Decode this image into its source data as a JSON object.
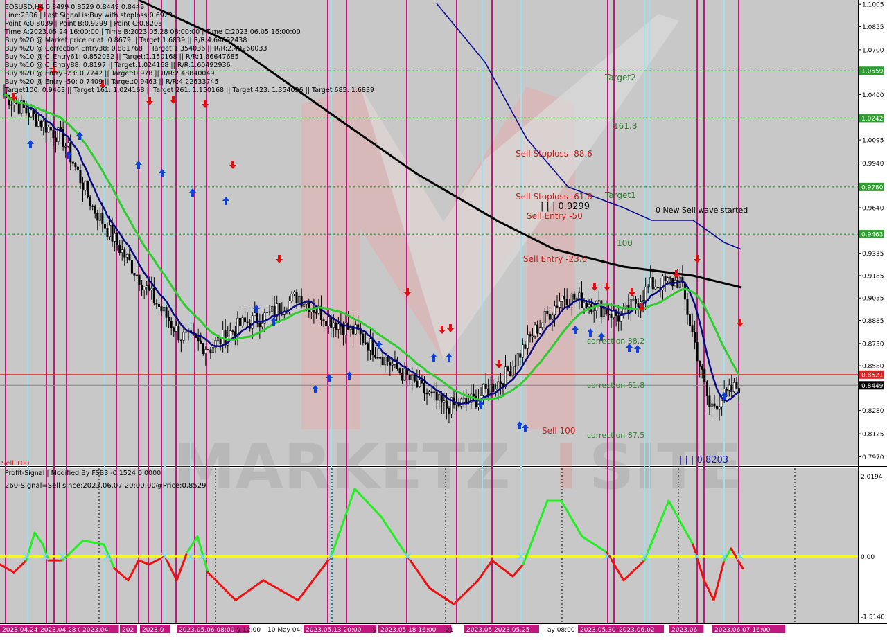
{
  "window": {
    "title": "EOSUSD,H4"
  },
  "header_lines": [
    "EOSUSD,H4  0.8499 0.8529 0.8449 0.8449",
    "Line:2306 | Last Signal is:Buy with stoploss:0.6923",
    "Point A:0.8039 | Point B:0.9299 | Point C:0.8203",
    "Time A:2023.05.24 16:00:00 | Time B:2023.05.28 08:00:00 | Time C:2023.06.05 16:00:00",
    "Buy %20 @ Market price or at: 0.8679 || Target:1.6839 || R/R:4.64692438",
    "Buy %20 @ Correction Entry38: 0.881768 || Target:1.354036 || R/R:2.49260033",
    "Buy %10 @ C_Entry61: 0.852032 || Target:1.150168 || R/R:1.86647685",
    "Buy %10 @ C_Entry88: 0.8197 || Target:1.024168 || R/R:1.60492936",
    "Buy %20 @ Entry -23: 0.7742 || Target:0.978 || R/R:2.48840049",
    "Buy %20 @ Entry -50: 0.7409 || Target:0.9463 || R/R:4.22633745",
    "Target100: 0.9463 || Target 161: 1.024168 || Target 261: 1.150168 || Target 423: 1.354036 || Target 685: 1.6839"
  ],
  "price_axis": {
    "ticks": [
      "1.1005",
      "1.0855",
      "1.0700",
      "1.0555",
      "1.0400",
      "1.0242",
      "1.0095",
      "0.9940",
      "0.9780",
      "0.9640",
      "0.9463",
      "0.9335",
      "0.9185",
      "0.9035",
      "0.8885",
      "0.8730",
      "0.8580",
      "0.8521",
      "0.8449",
      "0.8280",
      "0.8125",
      "0.7970"
    ],
    "tick_values": [
      1.1005,
      1.0855,
      1.07,
      1.0555,
      1.04,
      1.0242,
      1.0095,
      0.994,
      0.978,
      0.964,
      0.9463,
      0.9335,
      0.9185,
      0.9035,
      0.8885,
      0.873,
      0.858,
      0.8521,
      0.8449,
      0.828,
      0.8125,
      0.797
    ],
    "range": [
      0.793,
      1.102
    ],
    "labels": [
      {
        "text": "1.0559",
        "value": 1.0559,
        "color": "#2e9e2e"
      },
      {
        "text": "1.0242",
        "value": 1.0242,
        "color": "#2e9e2e"
      },
      {
        "text": "0.9780",
        "value": 0.978,
        "color": "#2e9e2e"
      },
      {
        "text": "0.9463",
        "value": 0.9463,
        "color": "#2e9e2e"
      },
      {
        "text": "0.8521",
        "value": 0.8521,
        "color": "#e02020"
      },
      {
        "text": "0.8449",
        "value": 0.8449,
        "color": "#000000"
      }
    ]
  },
  "annotations": [
    {
      "text": "Target2",
      "color": "#2e7d2e"
    },
    {
      "text": "161.8",
      "color": "#2e7d2e"
    },
    {
      "text": "Target1",
      "color": "#2e7d2e"
    },
    {
      "text": "100",
      "color": "#2e7d2e"
    },
    {
      "text": "Sell Stoploss -88.6",
      "color": "#d01818"
    },
    {
      "text": "Sell Stoploss -61.8",
      "color": "#d01818"
    },
    {
      "text": "Sell Entry -50",
      "color": "#d01818"
    },
    {
      "text": "Sell Entry -23.6",
      "color": "#d01818"
    },
    {
      "text": "Sell 100",
      "color": "#d01818"
    },
    {
      "text": "correction 38.2",
      "color": "#2e7d2e"
    },
    {
      "text": "correction 61.8",
      "color": "#2e7d2e"
    },
    {
      "text": "correction 87.5",
      "color": "#2e7d2e"
    },
    {
      "text": "0 New Sell wave started",
      "color": "#000000"
    },
    {
      "text": "| | | 0.9299",
      "color": "#000000"
    },
    {
      "text": "| | | 0.8203",
      "color": "#1a1aa0"
    },
    {
      "text": "Sell 100",
      "color": "#d01818"
    }
  ],
  "indicator": {
    "title": "Profit-Signal | Modified By FSB3 -0.1524 0.0000",
    "signal_text": "260-Signal=Sell since:2023.06.07 20:00:00@Price:0.8529",
    "ticks": [
      "2.0194",
      "0.00",
      "-1.5146"
    ],
    "tick_values": [
      2.0194,
      0.0,
      -1.5146
    ],
    "range": [
      -1.65,
      2.15
    ]
  },
  "time_axis": {
    "labels": [
      {
        "text": "2023.04.24",
        "highlight": true
      },
      {
        "text": "2023.04.28 00",
        "highlight": true
      },
      {
        "text": "2023.04.",
        "highlight": true
      },
      {
        "text": "202",
        "highlight": true
      },
      {
        "text": "2023.0",
        "highlight": true
      },
      {
        "text": "2023.05.06 08:00",
        "highlight": true
      },
      {
        "text": "y 12:00",
        "highlight": false
      },
      {
        "text": "10 May 04:",
        "highlight": false
      },
      {
        "text": "2023.05.13 20:00",
        "highlight": true
      },
      {
        "text": "y",
        "highlight": false
      },
      {
        "text": "2023.05.18 16:00",
        "highlight": true
      },
      {
        "text": "21",
        "highlight": false
      },
      {
        "text": "2023.05.",
        "highlight": true
      },
      {
        "text": "2023.05.25",
        "highlight": true
      },
      {
        "text": "ay 08:00",
        "highlight": false
      },
      {
        "text": "2023.05.30",
        "highlight": true
      },
      {
        "text": "2023.06.02",
        "highlight": true
      },
      {
        "text": "2023.06",
        "highlight": true
      },
      {
        "text": "2023.06.07 16:00",
        "highlight": true
      }
    ]
  },
  "colors": {
    "background": "#c8c8c8",
    "candle": "#000000",
    "ma_fast": "#0a0a80",
    "ma_mid": "#2ecc2e",
    "ma_slow": "#000000",
    "ma_blue": "#0a0a90",
    "magenta_line": "#c0187e",
    "cyan_line": "#9ee0ee",
    "signal_up": "#22ee22",
    "signal_down": "#ee1111",
    "zero_line": "#ffff00",
    "buy_arrow": "#1040e0",
    "sell_arrow": "#e01010"
  },
  "chart_data": {
    "type": "line",
    "title": "EOSUSD,H4",
    "series": [
      {
        "name": "EOSUSD,H4",
        "values": [
          1.04,
          1.025,
          1.01,
          0.965,
          0.935,
          0.905,
          0.878,
          0.87,
          0.885,
          0.892,
          0.905,
          0.89,
          0.88,
          0.862,
          0.845,
          0.83,
          0.835,
          0.85,
          0.88,
          0.905,
          0.9,
          0.89,
          0.912,
          0.915,
          0.83,
          0.8449
        ]
      }
    ],
    "ylim": [
      0.797,
      1.1005
    ],
    "xlabel": "",
    "ylabel": ""
  }
}
